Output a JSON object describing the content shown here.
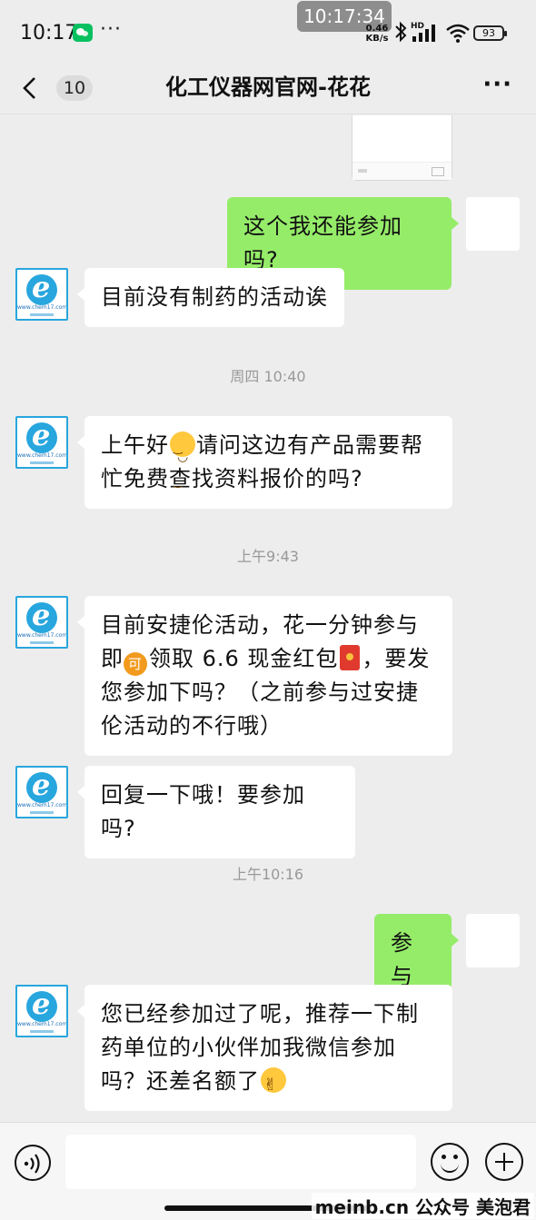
{
  "status_bar": {
    "time": "10:17",
    "more": "···",
    "clock_chip": "10:17:34",
    "net_speed_value": "0.46",
    "net_speed_unit": "KB/s",
    "signal_tag": "HD",
    "battery": "93"
  },
  "nav": {
    "unread_count": "10",
    "title": "化工仪器网官网-花花",
    "more": "···"
  },
  "timestamps": {
    "t1": "周四 10:40",
    "t2": "上午9:43",
    "t3": "上午10:16"
  },
  "avatar": {
    "site_text": "www.chem17.com"
  },
  "messages": {
    "m1": "这个我还能参加吗?",
    "m2": "目前没有制药的活动诶",
    "m3a": "上午好",
    "m3b": "请问这边有产品需要帮忙免费查找资料报价的吗?",
    "m4a": "目前安捷伦活动，花一分钟参与即",
    "m4_badge": "可",
    "m4b": "领取 6.6 现金红包",
    "m4c": "，要发您参加下吗？（之前参与过安捷伦活动的不行哦）",
    "m5": "回复一下哦！要参加吗?",
    "m6": "参与",
    "m7a": "您已经参加过了呢，推荐一下制药单位的小伙伴加我微信参加吗？还差名额了"
  },
  "input": {
    "placeholder": ""
  },
  "watermark": "meinb.cn  公众号 美泡君",
  "colors": {
    "chat_bg": "#ededed",
    "outgoing_bubble": "#95ec69",
    "incoming_bubble": "#ffffff",
    "avatar_accent": "#28a6de"
  }
}
